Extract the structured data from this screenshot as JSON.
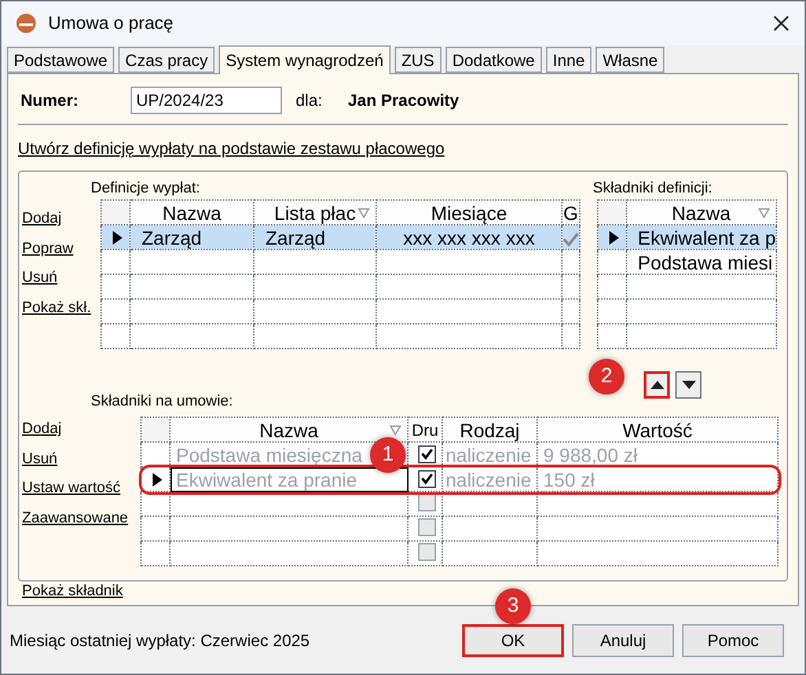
{
  "window": {
    "title": "Umowa o pracę"
  },
  "tabs": [
    {
      "label": "Podstawowe",
      "selected": false
    },
    {
      "label": "Czas pracy",
      "selected": false
    },
    {
      "label": "System wynagrodzeń",
      "selected": true
    },
    {
      "label": "ZUS",
      "selected": false
    },
    {
      "label": "Dodatkowe",
      "selected": false
    },
    {
      "label": "Inne",
      "selected": false
    },
    {
      "label": "Własne",
      "selected": false
    }
  ],
  "header": {
    "number_label": "Numer:",
    "number_value": "UP/2024/23",
    "for_label": "dla:",
    "employee": "Jan Pracowity"
  },
  "create_link": "Utwórz definicję wypłaty na podstawie zestawu płacowego",
  "definitions": {
    "label": "Definicje wypłat:",
    "actions": [
      "Dodaj",
      "Popraw",
      "Usuń",
      "Pokaż skł."
    ],
    "columns": [
      {
        "label": "Nazwa",
        "sort_icon": false
      },
      {
        "label": "Lista płac",
        "sort_icon": true
      },
      {
        "label": "Miesiące",
        "sort_icon": false
      },
      {
        "label": "G",
        "sort_icon": false
      }
    ],
    "rows": [
      {
        "name": "Zarząd",
        "list": "Zarząd",
        "months": "xxx xxx xxx xxx",
        "g_checked": true,
        "selected": true
      }
    ]
  },
  "definition_components": {
    "label": "Składniki definicji:",
    "columns": [
      {
        "label": "Nazwa",
        "sort_icon": true
      }
    ],
    "rows": [
      {
        "name": "Ekwiwalent za p",
        "selected": true
      },
      {
        "name": "Podstawa miesi",
        "selected": false
      }
    ]
  },
  "move_buttons": [
    {
      "kind": "up",
      "highlighted": true
    },
    {
      "kind": "down",
      "highlighted": false
    }
  ],
  "contract_components": {
    "label": "Składniki na umowie:",
    "actions": [
      "Dodaj",
      "Usuń",
      "Ustaw wartość",
      "Zaawansowane"
    ],
    "columns": [
      {
        "label": "Nazwa",
        "sort_icon": true
      },
      {
        "label": "Dru",
        "sort_icon": false
      },
      {
        "label": "Rodzaj",
        "sort_icon": false
      },
      {
        "label": "Wartość",
        "sort_icon": false
      }
    ],
    "rows": [
      {
        "name": "Podstawa miesięczna",
        "checked": true,
        "disabled": false,
        "type": "naliczenie",
        "value": "9 988,00 zł",
        "selected": false,
        "highlighted": false
      },
      {
        "name": "Ekwiwalent za pranie",
        "checked": true,
        "disabled": false,
        "type": "naliczenie",
        "value": "150 zł",
        "selected": true,
        "highlighted": true
      },
      {
        "checked": false,
        "disabled": true,
        "selected": false,
        "highlighted": false
      },
      {
        "checked": false,
        "disabled": true,
        "selected": false,
        "highlighted": false
      },
      {
        "checked": false,
        "disabled": true,
        "selected": false,
        "highlighted": false
      }
    ],
    "bottom_link": "Pokaż składnik"
  },
  "status": "Miesiąc ostatniej wypłaty: Czerwiec 2025",
  "buttons": [
    {
      "label": "OK",
      "highlighted": true
    },
    {
      "label": "Anuluj",
      "highlighted": false
    },
    {
      "label": "Pomoc",
      "highlighted": false
    }
  ],
  "badges": [
    {
      "label": "1"
    },
    {
      "label": "2"
    },
    {
      "label": "3"
    }
  ]
}
